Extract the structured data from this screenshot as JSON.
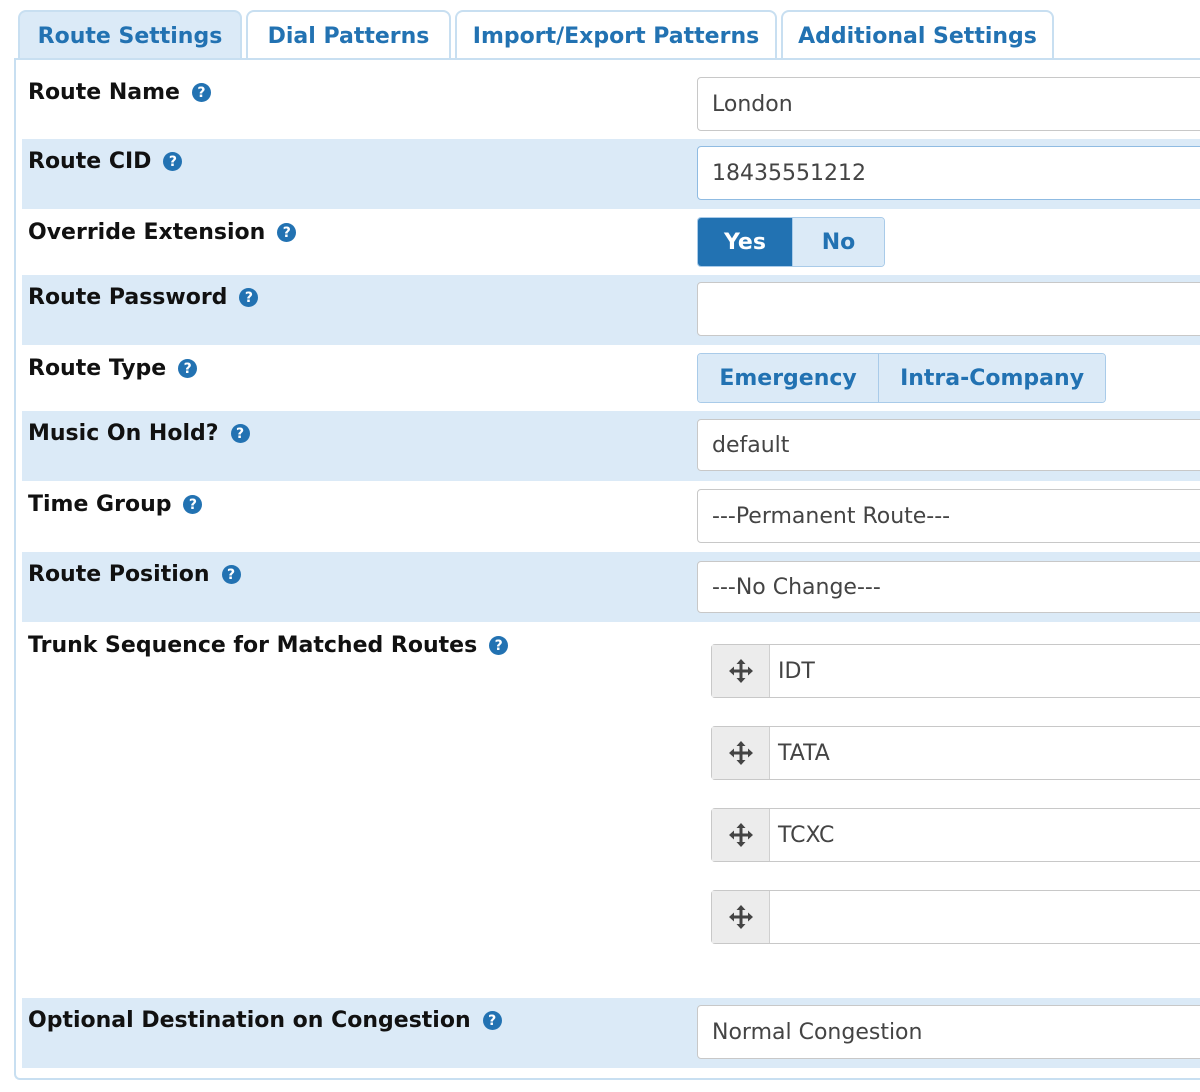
{
  "tabs": [
    {
      "label": "Route Settings",
      "active": true
    },
    {
      "label": "Dial Patterns",
      "active": false
    },
    {
      "label": "Import/Export Patterns",
      "active": false
    },
    {
      "label": "Additional Settings",
      "active": false
    }
  ],
  "help_glyph": "?",
  "fields": {
    "route_name": {
      "label": "Route Name",
      "value": "London"
    },
    "route_cid": {
      "label": "Route CID",
      "value": "18435551212"
    },
    "override_extension": {
      "label": "Override Extension",
      "options": [
        "Yes",
        "No"
      ],
      "selected": "Yes"
    },
    "route_password": {
      "label": "Route Password",
      "value": ""
    },
    "route_type": {
      "label": "Route Type",
      "options": [
        "Emergency",
        "Intra-Company"
      ],
      "selected": ""
    },
    "music_on_hold": {
      "label": "Music On Hold?",
      "value": "default"
    },
    "time_group": {
      "label": "Time Group",
      "value": "---Permanent Route---"
    },
    "route_position": {
      "label": "Route Position",
      "value": "---No Change---"
    },
    "trunk_sequence": {
      "label": "Trunk Sequence for Matched Routes",
      "trunks": [
        "IDT",
        "TATA",
        "TCXC",
        ""
      ]
    },
    "congestion": {
      "label": "Optional Destination on Congestion",
      "value": "Normal Congestion"
    }
  },
  "colors": {
    "accent": "#2272b2",
    "row_shade": "#dbeaf7",
    "tab_border": "#c8dff1"
  },
  "icons": {
    "help": "question-circle-icon",
    "drag": "move-arrows-icon"
  }
}
